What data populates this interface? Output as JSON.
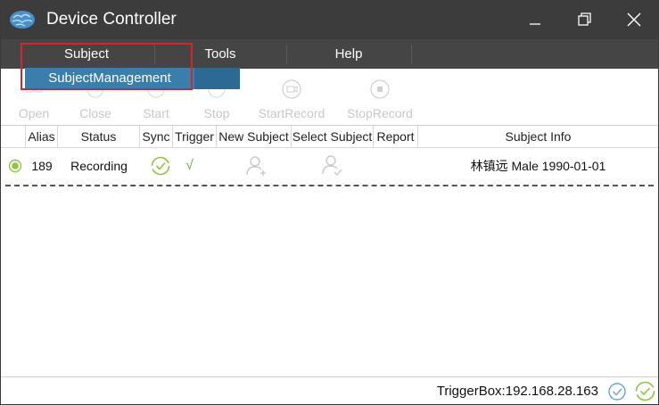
{
  "window": {
    "title": "Device Controller"
  },
  "menu": {
    "items": [
      {
        "label": "Subject"
      },
      {
        "label": "Tools"
      },
      {
        "label": "Help"
      }
    ],
    "dropdown": {
      "label": "SubjectManagement"
    }
  },
  "toolbar": {
    "buttons": [
      {
        "label": "Open"
      },
      {
        "label": "Close"
      },
      {
        "label": "Start"
      },
      {
        "label": "Stop"
      },
      {
        "label": "StartRecord"
      },
      {
        "label": "StopRecord"
      }
    ]
  },
  "table": {
    "columns": [
      "Alias",
      "Status",
      "Sync",
      "Trigger",
      "New Subject",
      "Select Subject",
      "Report",
      "Subject Info"
    ],
    "rows": [
      {
        "alias": "189",
        "status": "Recording",
        "trigger": "√",
        "subject_info": "林镇远 Male 1990-01-01"
      }
    ]
  },
  "statusbar": {
    "text": "TriggerBox:192.168.28.163"
  },
  "colors": {
    "titlebar": "#3c3c3c",
    "menubar": "#454545",
    "dropdown": "#3a7eab",
    "highlight": "#d0262c",
    "accent_green": "#8dc63f"
  }
}
